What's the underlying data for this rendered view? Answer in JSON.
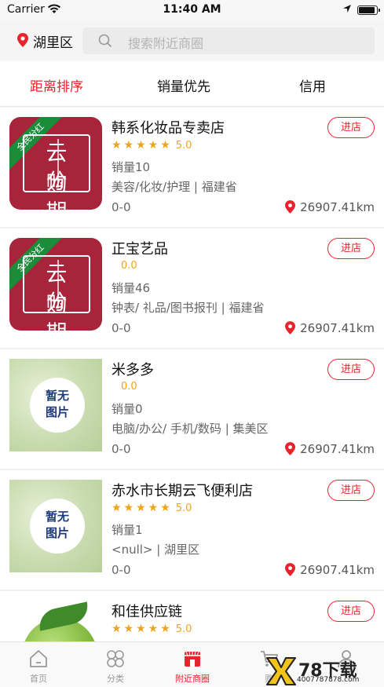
{
  "status_bar": {
    "carrier": "Carrier",
    "time": "11:40 AM"
  },
  "header": {
    "location": "湖里区",
    "search_placeholder": "搜索附近商圈"
  },
  "tabs": [
    {
      "label": "距离排序",
      "active": true
    },
    {
      "label": "销量优先",
      "active": false
    },
    {
      "label": "信用",
      "active": false
    }
  ],
  "stores": [
    {
      "name": "韩系化妆品专卖店",
      "stars": "★★★★★",
      "score": "5.0",
      "sales": "销量10",
      "category": "美容/化妆/护理 | 福建省",
      "hours": "0-0",
      "distance": "26907.41km",
      "thumb": "cloud-installment",
      "enter": "进店"
    },
    {
      "name": "正宝艺品",
      "stars": "",
      "score": "0.0",
      "sales": "销量46",
      "category": "钟表/ 礼品/图书报刊 | 福建省",
      "hours": "0-0",
      "distance": "26907.41km",
      "thumb": "cloud-installment",
      "enter": "进店"
    },
    {
      "name": "米多多",
      "stars": "",
      "score": "0.0",
      "sales": "销量0",
      "category": "电脑/办公/ 手机/数码 | 集美区",
      "hours": "0-0",
      "distance": "26907.41km",
      "thumb": "no-image",
      "enter": "进店"
    },
    {
      "name": "赤水市长期云飞便利店",
      "stars": "★★★★★",
      "score": "5.0",
      "sales": "销量1",
      "category": "<null> | 湖里区",
      "hours": "0-0",
      "distance": "26907.41km",
      "thumb": "no-image",
      "enter": "进店"
    },
    {
      "name": "和佳供应链",
      "stars": "★★★★★",
      "score": "5.0",
      "sales": "",
      "category": "",
      "hours": "",
      "distance": "",
      "thumb": "orange-fruit",
      "enter": "进店"
    }
  ],
  "thumb_text": {
    "ribbon": "全民分红",
    "line1": "云购",
    "line2": "分期",
    "no_image_line1": "暂无",
    "no_image_line2": "图片"
  },
  "tabbar": [
    {
      "label": "首页",
      "icon": "home-icon",
      "active": false
    },
    {
      "label": "分类",
      "icon": "category-icon",
      "active": false
    },
    {
      "label": "附近商圈",
      "icon": "nearby-shop-icon",
      "active": true
    },
    {
      "label": "购",
      "icon": "cart-icon",
      "active": false
    },
    {
      "label": "",
      "icon": "user-icon",
      "active": false
    }
  ],
  "watermark": {
    "text": "78下载",
    "url": "4007787878.com"
  },
  "colors": {
    "accent": "#e8232d",
    "star": "#f0a31c",
    "thumb_red": "#a7243a",
    "ribbon_green": "#1a8c3a"
  }
}
